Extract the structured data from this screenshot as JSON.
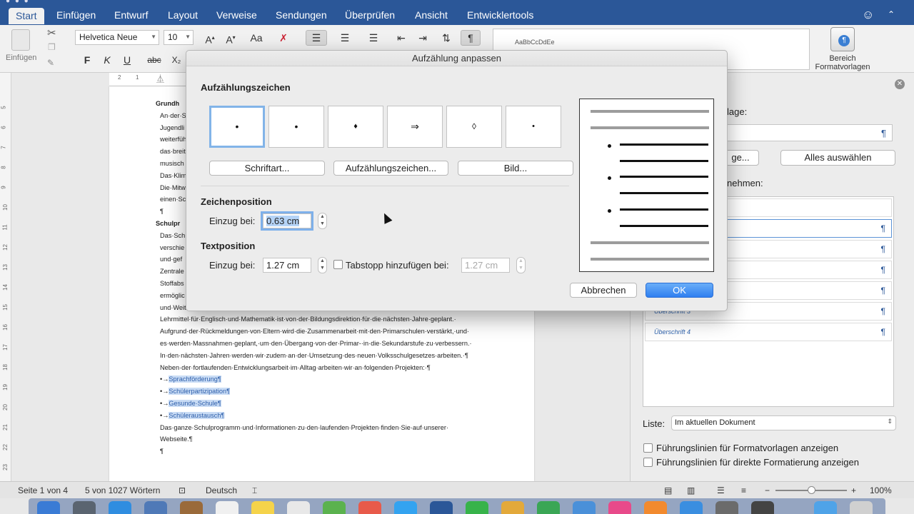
{
  "ribbon_tabs": [
    "Start",
    "Einfügen",
    "Entwurf",
    "Layout",
    "Verweise",
    "Sendungen",
    "Überprüfen",
    "Ansicht",
    "Entwicklertools"
  ],
  "ribbon": {
    "font_name": "Helvetica Neue",
    "font_size": "10",
    "paste_label": "Einfügen",
    "bold": "F",
    "italic": "K",
    "underline": "U",
    "strike": "abc",
    "subscript": "X₂",
    "style_preview": "AaBbCcDdEe",
    "pane_button": "Bereich\nFormatvorlagen"
  },
  "dialog": {
    "title": "Aufzählung anpassen",
    "section_symbols": "Aufzählungszeichen",
    "symbols": [
      "•",
      "•",
      "♦",
      "⇒",
      "◊",
      "•"
    ],
    "buttons": [
      "Schriftart...",
      "Aufzählungszeichen...",
      "Bild..."
    ],
    "section_char_pos": "Zeichenposition",
    "indent_label": "Einzug bei:",
    "char_indent_value": "0.63 cm",
    "section_text_pos": "Textposition",
    "text_indent_label": "Einzug bei:",
    "text_indent_value": "1.27 cm",
    "tab_label": "Tabstopp hinzufügen bei:",
    "tab_value": "1.27 cm",
    "cancel": "Abbrechen",
    "ok": "OK"
  },
  "document": {
    "lines": [
      {
        "text": "Grundh",
        "bold": true
      },
      {
        "text": "An·der·S"
      },
      {
        "text": "Jugendli"
      },
      {
        "text": "weiterfüh"
      },
      {
        "text": "das·breit"
      },
      {
        "text": "musisch"
      },
      {
        "text": "Das·Klim"
      },
      {
        "text": "Die·Mitw"
      },
      {
        "text": "einen·Sc"
      },
      {
        "text": "¶"
      },
      {
        "text": "Schulpr",
        "bold": true
      },
      {
        "text": "Das·Sch"
      },
      {
        "text": "verschie"
      },
      {
        "text": "und·gef"
      },
      {
        "text": "Zentrale"
      },
      {
        "text": "Stoffabs"
      },
      {
        "text": "ermöglic"
      },
      {
        "text": "und·Weiterbildung·der·Lehrpersonen·für·das·neue·Fach·Religion·und·Kultur·läuft,·die·Einführung·neuer"
      },
      {
        "text": "Lehrmittel·für·Englisch·und·Mathematik·ist·von·der·Bildungsdirektion·für·die·nächsten·Jahre·geplant.·"
      },
      {
        "text": "Aufgrund·der·Rückmeldungen·von·Eltern·wird·die·Zusammenarbeit·mit·den·Primarschulen·verstärkt,·und·"
      },
      {
        "text": "es·werden·Massnahmen·geplant,·um·den·Übergang·von·der·Primar-·in·die·Sekundarstufe·zu·verbessern.·"
      },
      {
        "text": "In·den·nächsten·Jahren·werden·wir·zudem·an·der·Umsetzung·des·neuen·Volksschulgesetzes·arbeiten.·¶"
      },
      {
        "text": "Neben·der·fortlaufenden·Entwicklungsarbeit·im·Alltag·arbeiten·wir·an·folgenden·Projekten:·¶"
      }
    ],
    "bullets": [
      "Sprachförderung¶",
      "Schülerpartizipation¶",
      "Gesunde·Schule¶",
      "Schüleraustausch¶"
    ],
    "bullet_prefix": "•→",
    "tail": [
      "Das·ganze·Schulprogramm·und·Informationen·zu·den·laufenden·Projekten·finden·Sie·auf·unserer·",
      "Webseite.¶",
      "¶"
    ],
    "ruler_numbers": [
      "5",
      "6",
      "7",
      "8",
      "9",
      "10",
      "11",
      "12",
      "13",
      "14",
      "15",
      "16",
      "17",
      "18",
      "19",
      "20",
      "21",
      "22",
      "23"
    ]
  },
  "styles_pane": {
    "partial_label_1": "lage:",
    "field_icon": "¶",
    "partial_button": "ge...",
    "select_all": "Alles auswählen",
    "partial_label_2": "nehmen:",
    "items": [
      "",
      "¶",
      "¶",
      "¶",
      "¶",
      "Überschrift 3",
      "Überschrift 4"
    ],
    "liste_label": "Liste:",
    "liste_value": "Im aktuellen Dokument",
    "check1": "Führungslinien für Formatvorlagen anzeigen",
    "check2": "Führungslinien für direkte Formatierung anzeigen"
  },
  "statusbar": {
    "page": "Seite 1 von 4",
    "words": "5 von 1027 Wörtern",
    "language": "Deutsch",
    "zoom": "100%"
  },
  "colors": {
    "ribbon_blue": "#2b5798",
    "ok_blue": "#2f7ff0",
    "selection": "#c9dcf5"
  }
}
